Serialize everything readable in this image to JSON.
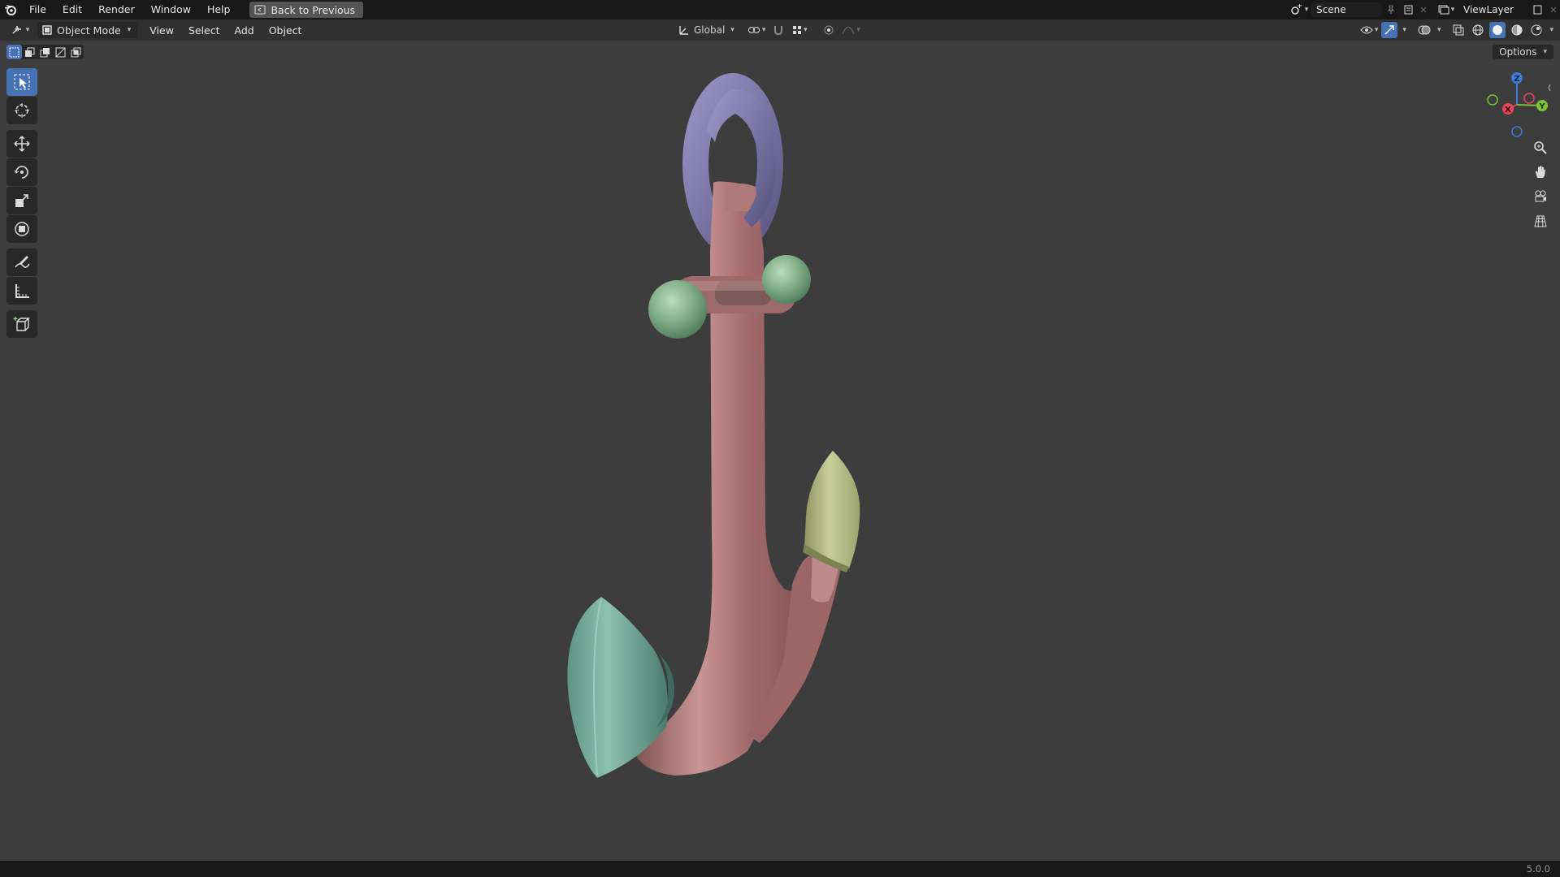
{
  "topbar": {
    "menu": [
      "File",
      "Edit",
      "Render",
      "Window",
      "Help"
    ],
    "back_button": "Back to Previous",
    "scene": "Scene",
    "view_layer": "ViewLayer"
  },
  "header": {
    "mode": "Object Mode",
    "menus": [
      "View",
      "Select",
      "Add",
      "Object"
    ],
    "orientation": "Global",
    "options": "Options"
  },
  "toolbar": {
    "tools": [
      "select-box",
      "cursor",
      "move",
      "rotate",
      "scale",
      "transform",
      "annotate",
      "measure",
      "add-cube"
    ],
    "active": "select-box"
  },
  "gizmo": {
    "axes": [
      "Z",
      "Y",
      "X"
    ]
  },
  "status": {
    "version": "5.0.0"
  },
  "colors": {
    "anchor_body": "#a06e6e",
    "ring": "#7e78a8",
    "stock_ends": "#7fae86",
    "left_fluke": "#6fa594",
    "right_fluke": "#b6bd88",
    "accent": "#4772b3"
  }
}
